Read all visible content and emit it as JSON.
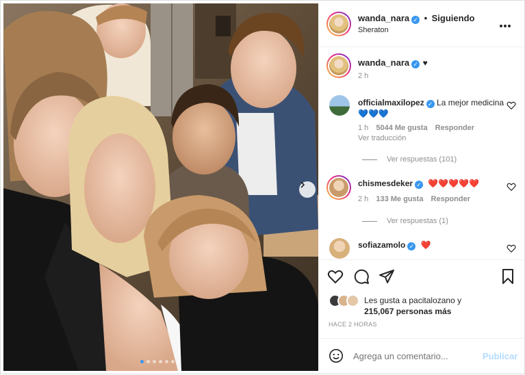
{
  "post": {
    "author": "wanda_nara",
    "follow_label": "Siguiendo",
    "location": "Sheraton",
    "caption_text": "♥",
    "caption_time": "2 h",
    "carousel_count": 7,
    "carousel_active_index": 0
  },
  "comments": [
    {
      "username": "officialmaxilopez",
      "verified": true,
      "text": "La mejor medicina 💙💙💙",
      "time": "1 h",
      "likes": "5044 Me gusta",
      "reply_label": "Responder",
      "translate_label": "Ver traducción",
      "view_replies": "Ver respuestas (101)"
    },
    {
      "username": "chismesdeker",
      "verified": true,
      "text": "❤️❤️❤️❤️❤️",
      "time": "2 h",
      "likes": "133 Me gusta",
      "reply_label": "Responder",
      "view_replies": "Ver respuestas (1)"
    },
    {
      "username": "sofiazamolo",
      "verified": true,
      "text": "❤️"
    }
  ],
  "likes": {
    "line1": "Les gusta a pacitalozano y",
    "line2": "215,067 personas más"
  },
  "timestamp": "HACE 2 HORAS",
  "composer": {
    "placeholder": "Agrega un comentario...",
    "post_label": "Publicar"
  },
  "icons": {
    "more": "more-options-icon",
    "like": "heart-icon",
    "comment": "comment-icon",
    "share": "share-icon",
    "save": "bookmark-icon",
    "emoji": "emoji-icon",
    "next": "chevron-right-icon",
    "verified": "verified-badge-icon"
  },
  "colors": {
    "accent": "#3897f0",
    "muted": "#8e8e8e",
    "text": "#262626",
    "heart_red": "#ed4956"
  }
}
